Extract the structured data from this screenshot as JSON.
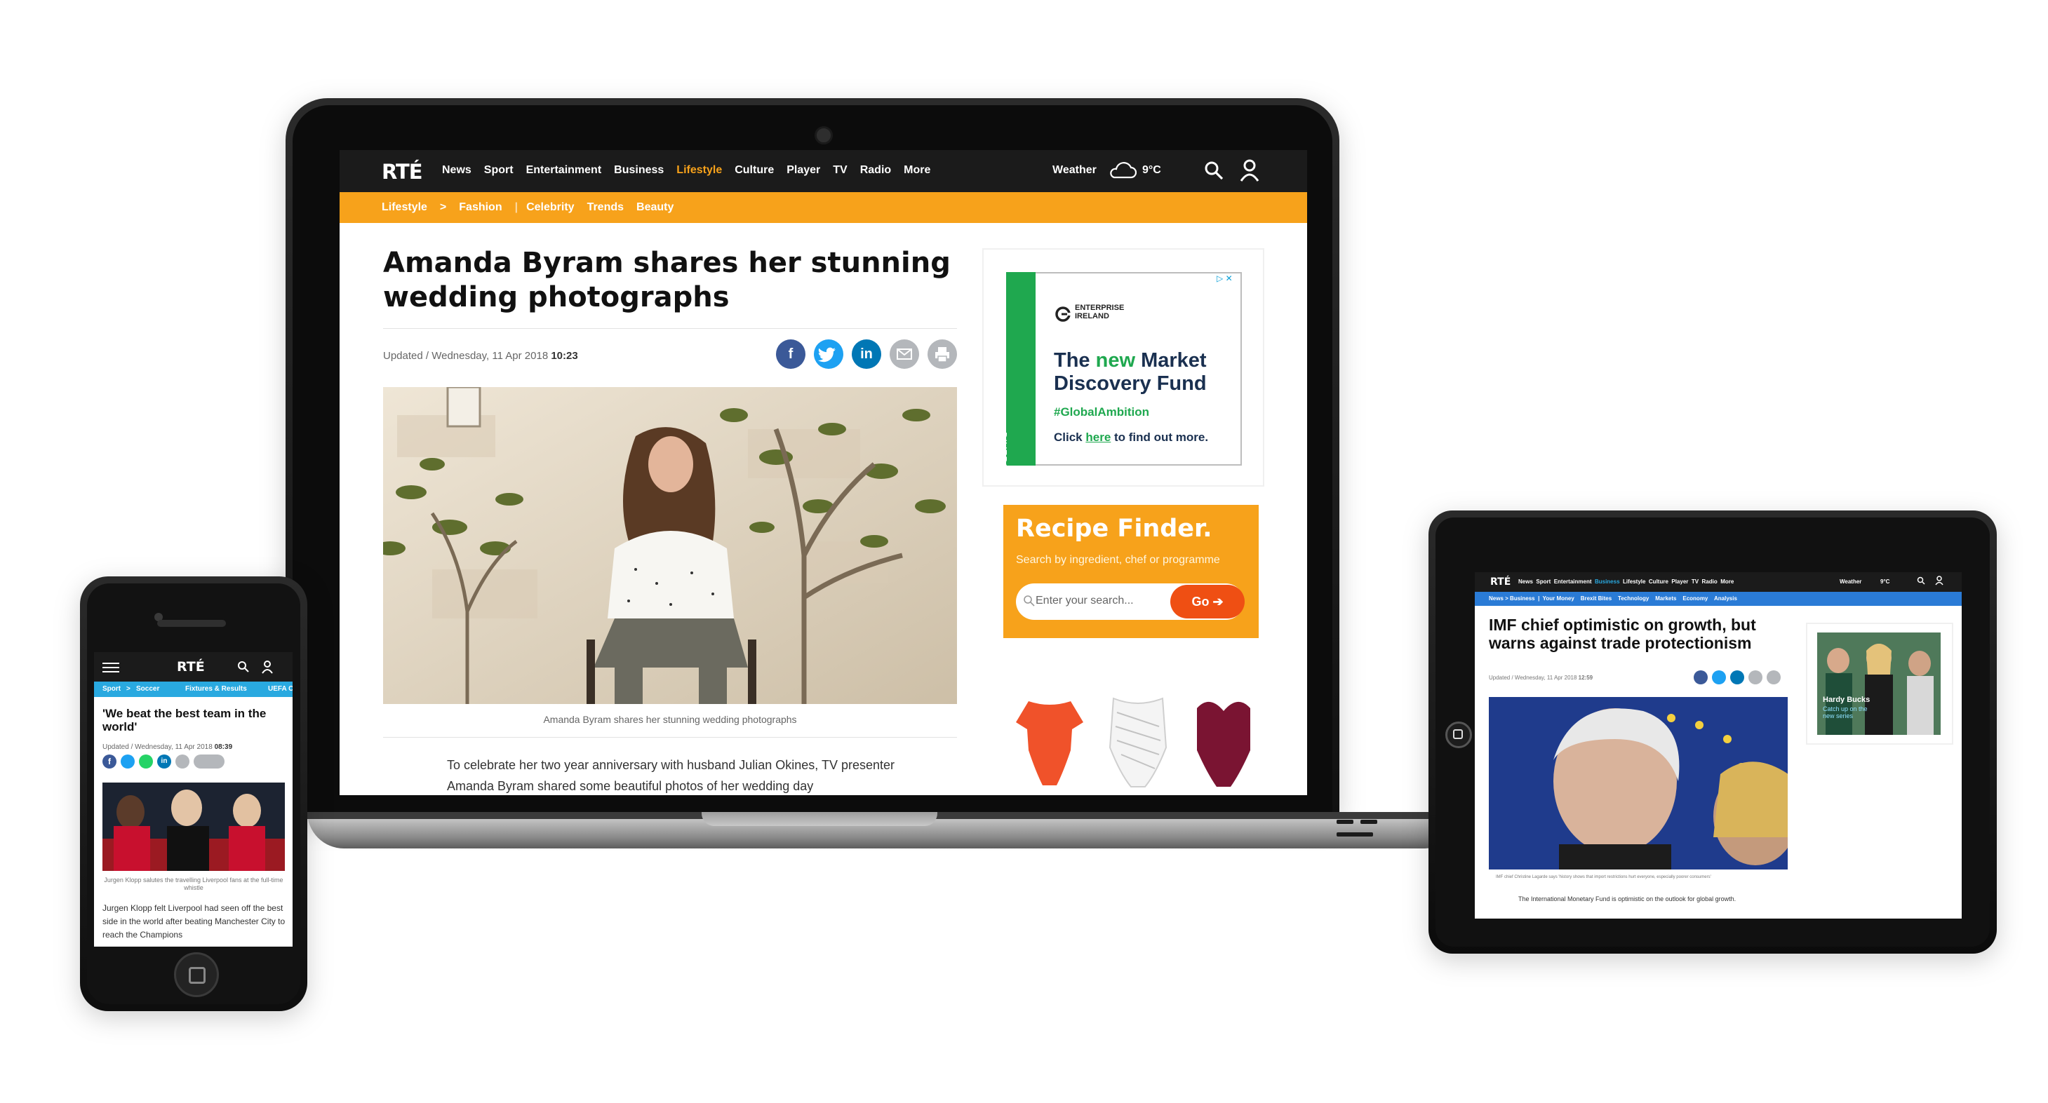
{
  "laptop": {
    "brand": "RTÉ",
    "nav": [
      "News",
      "Sport",
      "Entertainment",
      "Business",
      "Lifestyle",
      "Culture",
      "Player",
      "TV",
      "Radio",
      "More"
    ],
    "nav_active": "Lifestyle",
    "weather_label": "Weather",
    "temperature": "9°C",
    "breadcrumb": {
      "section": "Lifestyle",
      "separator": ">",
      "current": "Fashion"
    },
    "subnav": [
      "Celebrity",
      "Trends",
      "Beauty"
    ],
    "headline": "Amanda Byram shares her stunning wedding photographs",
    "updated_prefix": "Updated / Wednesday, 11 Apr 2018",
    "updated_time": "10:23",
    "share_icons": [
      "facebook-icon",
      "twitter-icon",
      "linkedin-icon",
      "email-icon",
      "print-icon"
    ],
    "photo_caption": "Amanda Byram shares her stunning wedding photographs",
    "body_text": "To celebrate her two year anniversary with husband Julian Okines, TV presenter Amanda Byram shared some beautiful photos of her wedding day",
    "ad": {
      "badge": "▷ ✕",
      "logo_text": "ENTERPRISE\nIRELAND",
      "side_text": "DIVERSIFY",
      "heading_1": "The ",
      "heading_new": "new",
      "heading_2": " Market Discovery Fund",
      "hashtag": "#GlobalAmbition",
      "cta_prefix": "Click ",
      "cta_link": "here",
      "cta_suffix": " to find out more."
    },
    "recipe": {
      "title": "Recipe Finder.",
      "subtitle": "Search by ingredient, chef or programme",
      "placeholder": "Enter your search...",
      "go_label": "Go"
    },
    "colors": {
      "accent": "#f7a21b",
      "dark": "#1b1b1b",
      "facebook": "#3b5998",
      "twitter": "#1da1f2",
      "linkedin": "#0077b5",
      "grey": "#b4b7bb",
      "go": "#ef4f13",
      "ad_green": "#1fa84f"
    }
  },
  "phone": {
    "brand": "RTÉ",
    "crumb": [
      "Sport",
      ">",
      "Soccer",
      "Fixtures & Results",
      "UEFA C"
    ],
    "headline": "'We beat the best team in the world'",
    "updated_prefix": "Updated / Wednesday, 11 Apr 2018",
    "updated_time": "08:39",
    "caption": "Jurgen Klopp salutes the travelling Liverpool fans at the full-time whistle",
    "body_text": "Jurgen Klopp felt Liverpool had seen off the best side in the world after beating Manchester City to reach the Champions"
  },
  "tablet": {
    "brand": "RTÉ",
    "nav": [
      "News",
      "Sport",
      "Entertainment",
      "Business",
      "Lifestyle",
      "Culture",
      "Player",
      "TV",
      "Radio",
      "More"
    ],
    "weather_label": "Weather",
    "temperature": "9°C",
    "subnav": [
      "News",
      ">",
      "Business",
      "Your Money",
      "Brexit Bites",
      "Technology",
      "Markets",
      "Economy",
      "Analysis"
    ],
    "headline": "IMF chief optimistic on growth, but warns against trade protectionism",
    "updated_prefix": "Updated / Wednesday, 11 Apr 2018",
    "updated_time": "12:59",
    "caption": "IMF chief Christine Lagarde says 'history shows that import restrictions hurt everyone, especially poorer consumers'",
    "body_text": "The International Monetary Fund is optimistic on the outlook for global growth.",
    "promo_title": "Hardy Bucks",
    "promo_sub": "Catch up on the new series"
  }
}
